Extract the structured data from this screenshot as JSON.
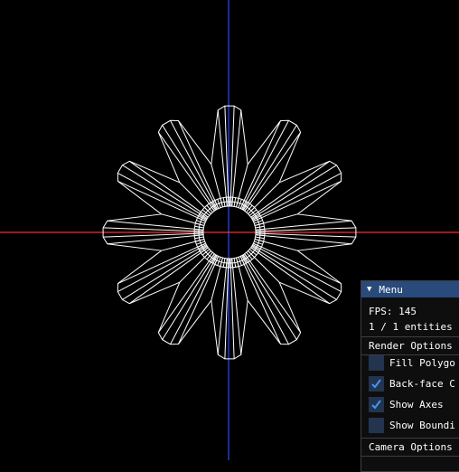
{
  "colors": {
    "background": "#000000",
    "x_axis": "#ff2a2a",
    "y_axis": "#2a4dff",
    "wireframe": "#ffffff",
    "panel_title": "#294a7a",
    "checkbox": "#23344f",
    "checkmark": "#4296fa"
  },
  "menu": {
    "title": "Menu",
    "collapse_icon": "triangle-down-icon",
    "fps": "FPS: 145",
    "entities": "1 / 1 entities",
    "render_options": {
      "header": "Render Options",
      "fill_polygons": {
        "label": "Fill Polygo",
        "checked": false
      },
      "backface_culling": {
        "label": "Back-face C",
        "checked": true
      },
      "show_axes": {
        "label": "Show Axes",
        "checked": true
      },
      "show_bounding": {
        "label": "Show Boundi",
        "checked": false
      }
    },
    "camera_options": {
      "header": "Camera Options"
    }
  }
}
